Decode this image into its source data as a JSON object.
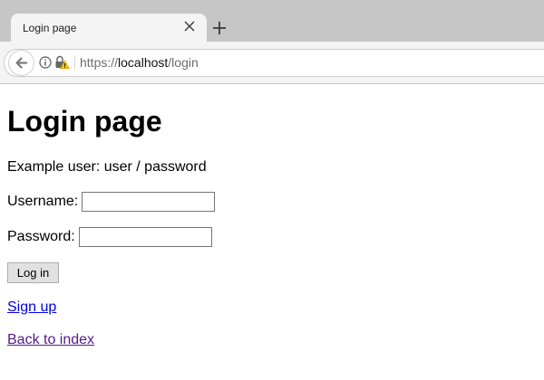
{
  "browser": {
    "tab_title": "Login page",
    "url_scheme": "https://",
    "url_host": "localhost",
    "url_path": "/login",
    "icons": [
      "close-icon",
      "plus-icon",
      "back-arrow-icon",
      "info-icon",
      "insecure-lock-icon"
    ],
    "colors": {
      "tabstrip": "#c6c6c6",
      "toolbar": "#f4f4f4",
      "warning": "#f5c211"
    }
  },
  "page": {
    "heading": "Login page",
    "example_text": "Example user: user / password",
    "username_label": "Username:",
    "username_value": "",
    "password_label": "Password:",
    "password_value": "",
    "login_button": "Log in",
    "signup_link": "Sign up",
    "back_link": "Back to index",
    "colors": {
      "link": "#0000ee",
      "visited_link": "#551a8b"
    }
  }
}
